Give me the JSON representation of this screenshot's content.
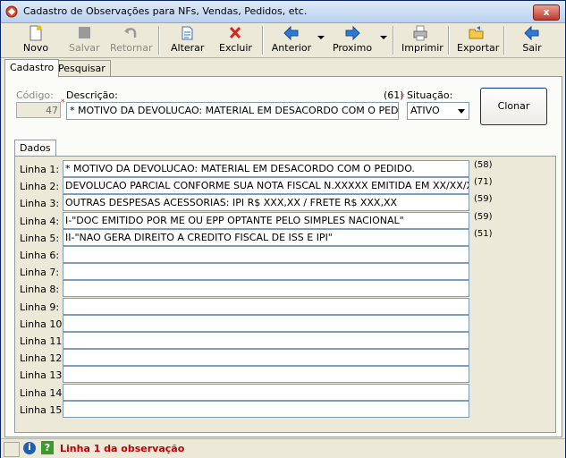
{
  "window": {
    "title": "Cadastro de Observações para NFs, Vendas, Pedidos, etc.",
    "close_label": "x"
  },
  "toolbar": {
    "novo": "Novo",
    "salvar": "Salvar",
    "retornar": "Retornar",
    "alterar": "Alterar",
    "excluir": "Excluir",
    "anterior": "Anterior",
    "proximo": "Proximo",
    "imprimir": "Imprimir",
    "exportar": "Exportar",
    "sair": "Sair"
  },
  "tabs": {
    "cadastro": "Cadastro",
    "pesquisar": "Pesquisar"
  },
  "form": {
    "codigo_label": "Código:",
    "codigo_value": "47",
    "descricao_label": "Descrição:",
    "descricao_count": "(61)",
    "descricao_value": "* MOTIVO DA DEVOLUCAO: MATERIAL EM DESACORDO COM O PEDIDO.",
    "situacao_label": "Situação:",
    "situacao_value": "ATIVO",
    "clonar_label": "Clonar"
  },
  "dados_tab": "Dados",
  "lines": [
    {
      "label": "Linha 1:",
      "value": "* MOTIVO DA DEVOLUCAO: MATERIAL EM DESACORDO COM O PEDIDO.",
      "count": "(58)"
    },
    {
      "label": "Linha 2:",
      "value": "DEVOLUCAO PARCIAL CONFORME SUA NOTA FISCAL N.XXXXX EMITIDA EM XX/XX/XX.",
      "count": "(71)"
    },
    {
      "label": "Linha 3:",
      "value": "OUTRAS DESPESAS ACESSORIAS: IPI R$ XXX,XX / FRETE R$ XXX,XX",
      "count": "(59)"
    },
    {
      "label": "Linha 4:",
      "value": "I-\"DOC EMITIDO POR ME OU EPP OPTANTE PELO SIMPLES NACIONAL\"",
      "count": "(59)"
    },
    {
      "label": "Linha 5:",
      "value": "II-\"NAO GERA DIREITO A CREDITO FISCAL DE ISS E IPI\"",
      "count": "(51)"
    },
    {
      "label": "Linha 6:",
      "value": "",
      "count": ""
    },
    {
      "label": "Linha 7:",
      "value": "",
      "count": ""
    },
    {
      "label": "Linha 8:",
      "value": "",
      "count": ""
    },
    {
      "label": "Linha 9:",
      "value": "",
      "count": ""
    },
    {
      "label": "Linha 10:",
      "value": "",
      "count": ""
    },
    {
      "label": "Linha 11:",
      "value": "",
      "count": ""
    },
    {
      "label": "Linha 12:",
      "value": "",
      "count": ""
    },
    {
      "label": "Linha 13:",
      "value": "",
      "count": ""
    },
    {
      "label": "Linha 14:",
      "value": "",
      "count": ""
    },
    {
      "label": "Linha 15:",
      "value": "",
      "count": ""
    }
  ],
  "status": {
    "text": "Linha 1 da observação",
    "info_icon": "i",
    "help_icon": "?"
  },
  "colors": {
    "status_text": "#c00000",
    "title_gradient": "#b9d1ee",
    "accent_blue": "#1e5fb4"
  }
}
